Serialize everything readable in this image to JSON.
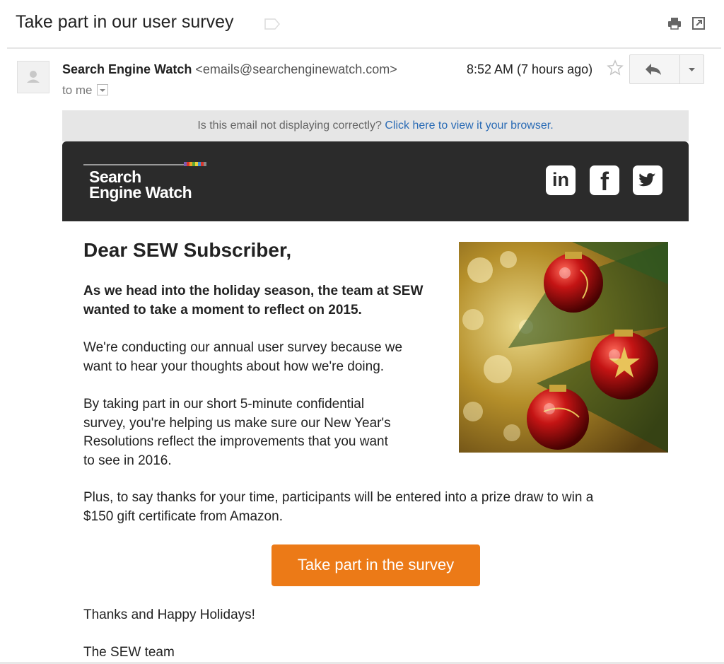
{
  "email": {
    "subject": "Take part in our user survey",
    "sender_name": "Search Engine Watch",
    "sender_email": "<emails@searchenginewatch.com>",
    "recipient": "to me",
    "time": "8:52 AM (7 hours ago)"
  },
  "toolbar": {
    "icons": [
      "print-icon",
      "new-window-icon",
      "star-icon",
      "reply-icon",
      "chevron-down-icon"
    ]
  },
  "notice": {
    "text": "Is this email not displaying correctly?",
    "link": "Click here to view it your browser."
  },
  "brand": {
    "logo_line1": "Search",
    "logo_line2": "Engine Watch",
    "header_color": "#2b2b2b",
    "social": [
      {
        "icon": "linkedin-icon",
        "glyph": "in"
      },
      {
        "icon": "facebook-icon",
        "glyph": "f"
      },
      {
        "icon": "twitter-icon",
        "glyph": ""
      }
    ]
  },
  "body": {
    "greeting": "Dear SEW Subscriber,",
    "intro_line1": "As we head into the holiday season, the team at SEW",
    "intro_line2": "wanted to take a moment to reflect on 2015.",
    "p1_line1": "We're conducting our annual user survey because we",
    "p1_line2": "want to hear your thoughts about how we're doing.",
    "p2_line1": "By taking part in our short 5-minute confidential",
    "p2_line2": "survey, you're helping us make sure our New Year's",
    "p2_line3": "Resolutions reflect the improvements that you want",
    "p2_line4": "to see in 2016.",
    "p3_line1": "Plus, to say thanks for your time, participants will be entered into a prize draw to win a",
    "p3_line2": "$150 gift certificate from Amazon.",
    "cta_label": "Take part in the survey",
    "cta_color": "#ec7a17",
    "closing": "Thanks and Happy Holidays!",
    "signature": "The SEW team"
  },
  "link_color": "#2a6bb5"
}
